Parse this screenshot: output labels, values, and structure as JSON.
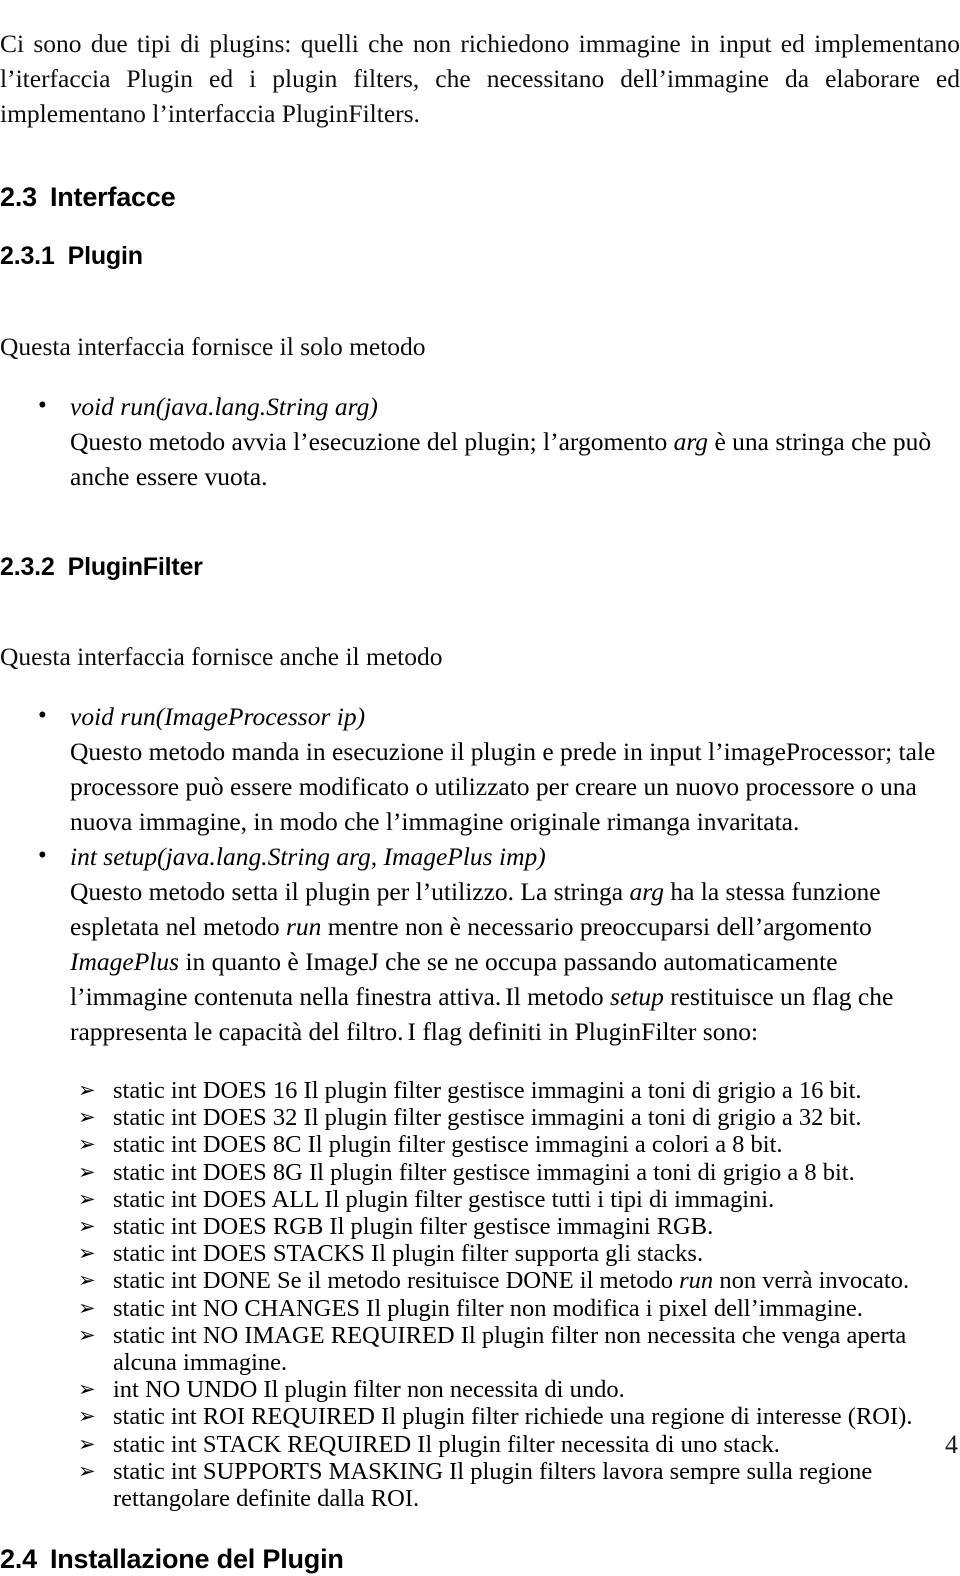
{
  "document": {
    "page_number": "4",
    "intro_paragraph": "Ci sono due tipi di plugins: quelli che non richiedono immagine in input ed implementano l’iterfaccia Plugin ed i plugin filters, che necessitano dell’immagine da elaborare ed implementano l’interfaccia PluginFilters."
  },
  "sections": [
    {
      "number": "2.3",
      "title": "Interfacce",
      "level": 2
    },
    {
      "number": "2.3.1",
      "title": "Plugin",
      "level": 3,
      "intro": "Questa interfaccia fornisce il solo metodo",
      "methods": [
        {
          "signature": "void run(java.lang.String arg)",
          "description_parts": [
            {
              "text": "Questo metodo  avvia l’esecuzione del plugin; l’argomento ",
              "style": "normal"
            },
            {
              "text": "arg",
              "style": "italic"
            },
            {
              "text": " è una stringa che può anche essere vuota.",
              "style": "normal"
            }
          ]
        }
      ]
    },
    {
      "number": "2.3.2",
      "title": "PluginFilter",
      "level": 3,
      "intro": "Questa interfaccia fornisce anche il metodo",
      "methods": [
        {
          "signature": "void run(ImageProcessor ip)",
          "description_parts": [
            {
              "text": "Questo metodo manda in esecuzione il plugin e prede in input l’imageProcessor; tale processore può essere modificato o utilizzato per creare un nuovo processore o una nuova immagine, in modo che l’immagine originale rimanga invaritata.",
              "style": "normal"
            }
          ]
        },
        {
          "signature": "int setup(java.lang.String arg, ImagePlus imp)",
          "description_parts": [
            {
              "text": "Questo metodo setta il plugin per l’utilizzo. La stringa ",
              "style": "normal"
            },
            {
              "text": "arg",
              "style": "italic"
            },
            {
              "text": " ha la stessa funzione espletata nel metodo ",
              "style": "normal"
            },
            {
              "text": "run",
              "style": "italic"
            },
            {
              "text": "  mentre non è necessario preoccuparsi dell’argomento ",
              "style": "normal"
            },
            {
              "text": "ImagePlus",
              "style": "italic"
            },
            {
              "text": "  in quanto è ImageJ che se ne occupa passando automaticamente l’immagine contenuta nella finestra attiva.",
              "style": "normal"
            }
          ],
          "extra_lines": [
            [
              {
                "text": "Il metodo ",
                "style": "normal"
              },
              {
                "text": "setup",
                "style": "italic"
              },
              {
                "text": " restituisce un flag che rappresenta le capacità del filtro.",
                "style": "normal"
              }
            ],
            [
              {
                "text": "I flag definiti in PluginFilter sono:",
                "style": "normal"
              }
            ]
          ]
        }
      ],
      "flags": [
        [
          {
            "text": "static int DOES 16 Il plugin filter gestisce immagini a toni di grigio a 16 bit.",
            "style": "normal"
          }
        ],
        [
          {
            "text": "static int DOES 32 Il plugin filter gestisce immagini a toni di grigio a 32 bit.",
            "style": "normal"
          }
        ],
        [
          {
            "text": "static int DOES 8C Il plugin filter gestisce immagini a colori a 8 bit.",
            "style": "normal"
          }
        ],
        [
          {
            "text": "static int DOES 8G Il plugin filter gestisce immagini a toni di grigio a 8 bit.",
            "style": "normal"
          }
        ],
        [
          {
            "text": "static int DOES ALL Il plugin filter gestisce tutti i tipi di immagini.",
            "style": "normal"
          }
        ],
        [
          {
            "text": "static int DOES RGB Il plugin filter gestisce immagini RGB.",
            "style": "normal"
          }
        ],
        [
          {
            "text": "static int DOES STACKS Il plugin filter supporta gli stacks.",
            "style": "normal"
          }
        ],
        [
          {
            "text": "static int DONE Se il metodo  resituisce DONE il metodo ",
            "style": "normal"
          },
          {
            "text": "run",
            "style": "italic"
          },
          {
            "text": " non verrà invocato.",
            "style": "normal"
          }
        ],
        [
          {
            "text": "static int NO CHANGES Il plugin filter non modifica i pixel dell’immagine.",
            "style": "normal"
          }
        ],
        [
          {
            "text": "static int NO IMAGE REQUIRED Il plugin filter non necessita che venga aperta alcuna immagine.",
            "style": "normal"
          }
        ],
        [
          {
            "text": "int NO UNDO Il plugin filter non necessita di undo.",
            "style": "normal"
          }
        ],
        [
          {
            "text": "static int ROI REQUIRED Il plugin filter richiede una regione di interesse (ROI).",
            "style": "normal"
          }
        ],
        [
          {
            "text": "static int STACK REQUIRED Il plugin filter necessita di uno stack.",
            "style": "normal"
          }
        ],
        [
          {
            "text": "static int SUPPORTS MASKING Il plugin filters lavora sempre sulla regione rettangolare definite dalla ROI.",
            "style": "normal"
          }
        ]
      ]
    },
    {
      "number": "2.4",
      "title": "Installazione del Plugin",
      "level": 2
    }
  ]
}
